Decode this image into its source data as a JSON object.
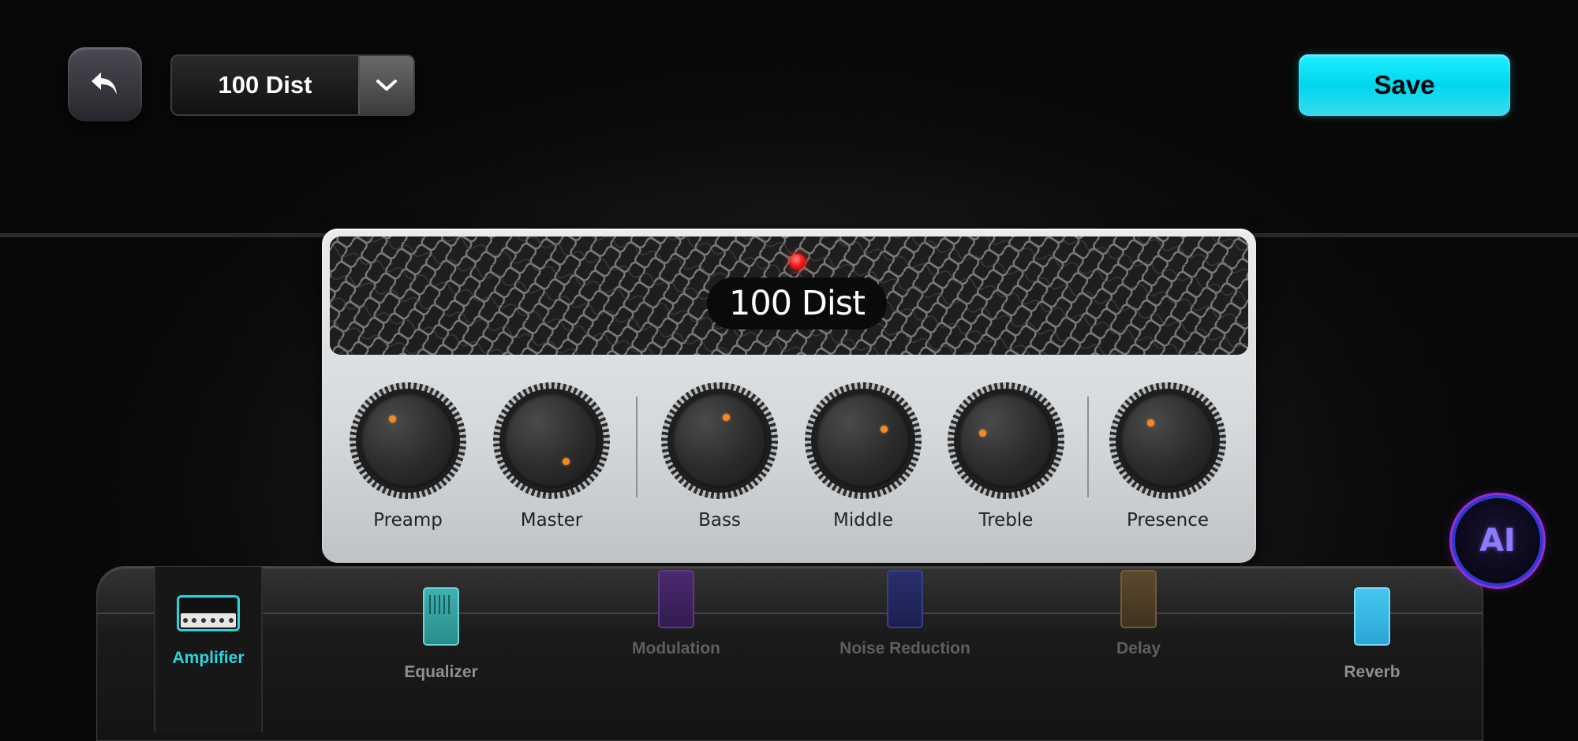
{
  "header": {
    "preset_name": "100 Dist",
    "save_label": "Save"
  },
  "amp": {
    "name": "100 Dist",
    "knobs": [
      {
        "label": "Preamp"
      },
      {
        "label": "Master"
      },
      {
        "label": "Bass"
      },
      {
        "label": "Middle"
      },
      {
        "label": "Treble"
      },
      {
        "label": "Presence"
      }
    ],
    "led_color": "#ff1b1b",
    "knob_indicator_color": "#f08a2c"
  },
  "effects_tray": {
    "items": [
      {
        "label": "Amplifier",
        "active": true
      },
      {
        "label": "Equalizer",
        "active": false
      },
      {
        "label": "Modulation",
        "active": false
      },
      {
        "label": "Noise Reduction",
        "active": false
      },
      {
        "label": "Delay",
        "active": false
      },
      {
        "label": "Reverb",
        "active": false
      }
    ],
    "active_color": "#2fd3dc"
  },
  "ai_button": {
    "label": "AI"
  },
  "colors": {
    "save_button": "#1ee6f5",
    "background": "#0c0c0c"
  }
}
